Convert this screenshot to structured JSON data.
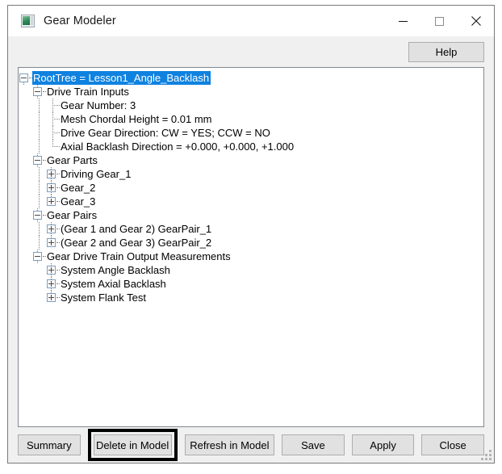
{
  "window": {
    "title": "Gear Modeler",
    "icon": "gear-modeler-window-icon",
    "controls": {
      "minimize": "minimize-icon",
      "maximize": "maximize-icon",
      "close": "close-icon"
    }
  },
  "toolbar": {
    "help_label": "Help"
  },
  "tree": {
    "selected_node": "RootTree = Lesson1_Angle_Backlash",
    "nodes": [
      {
        "label": "RootTree = Lesson1_Angle_Backlash",
        "depth": 0,
        "expander": "minus",
        "selected": true
      },
      {
        "label": "Drive Train Inputs",
        "depth": 1,
        "expander": "minus",
        "selected": false
      },
      {
        "label": "Gear Number: 3",
        "depth": 2,
        "expander": "none",
        "selected": false
      },
      {
        "label": "Mesh Chordal Height = 0.01 mm",
        "depth": 2,
        "expander": "none",
        "selected": false
      },
      {
        "label": "Drive Gear Direction: CW = YES; CCW = NO",
        "depth": 2,
        "expander": "none",
        "selected": false
      },
      {
        "label": "Axial Backlash Direction = +0.000, +0.000, +1.000",
        "depth": 2,
        "expander": "none",
        "selected": false
      },
      {
        "label": "Gear Parts",
        "depth": 1,
        "expander": "minus",
        "selected": false
      },
      {
        "label": "Driving Gear_1",
        "depth": 2,
        "expander": "plus",
        "selected": false
      },
      {
        "label": "Gear_2",
        "depth": 2,
        "expander": "plus",
        "selected": false
      },
      {
        "label": "Gear_3",
        "depth": 2,
        "expander": "plus",
        "selected": false
      },
      {
        "label": "Gear Pairs",
        "depth": 1,
        "expander": "minus",
        "selected": false
      },
      {
        "label": "(Gear 1 and Gear 2) GearPair_1",
        "depth": 2,
        "expander": "plus",
        "selected": false
      },
      {
        "label": "(Gear 2 and Gear 3) GearPair_2",
        "depth": 2,
        "expander": "plus",
        "selected": false
      },
      {
        "label": "Gear Drive Train Output Measurements",
        "depth": 1,
        "expander": "minus",
        "selected": false
      },
      {
        "label": "System Angle Backlash",
        "depth": 2,
        "expander": "plus",
        "selected": false
      },
      {
        "label": "System Axial Backlash",
        "depth": 2,
        "expander": "plus",
        "selected": false
      },
      {
        "label": "System Flank Test",
        "depth": 2,
        "expander": "plus",
        "selected": false
      }
    ]
  },
  "footer": {
    "buttons": [
      {
        "label": "Summary",
        "name": "summary-button",
        "width_class": "w-summary",
        "highlighted": false
      },
      {
        "label": "Delete in Model",
        "name": "delete-in-model-button",
        "width_class": "w-delete",
        "highlighted": true
      },
      {
        "label": "Refresh in Model",
        "name": "refresh-in-model-button",
        "width_class": "w-refresh",
        "highlighted": false
      },
      {
        "label": "Save",
        "name": "save-button",
        "width_class": "w-save",
        "highlighted": false
      },
      {
        "label": "Apply",
        "name": "apply-button",
        "width_class": "w-apply",
        "highlighted": false
      },
      {
        "label": "Close",
        "name": "close-button",
        "width_class": "w-close",
        "highlighted": false
      }
    ]
  },
  "colors": {
    "selection_blue": "#0f82e0",
    "window_chrome": "#f0f0f0",
    "panel_white": "#ffffff",
    "highlight_outline": "#000000",
    "icon_green": "#2e8b57"
  }
}
